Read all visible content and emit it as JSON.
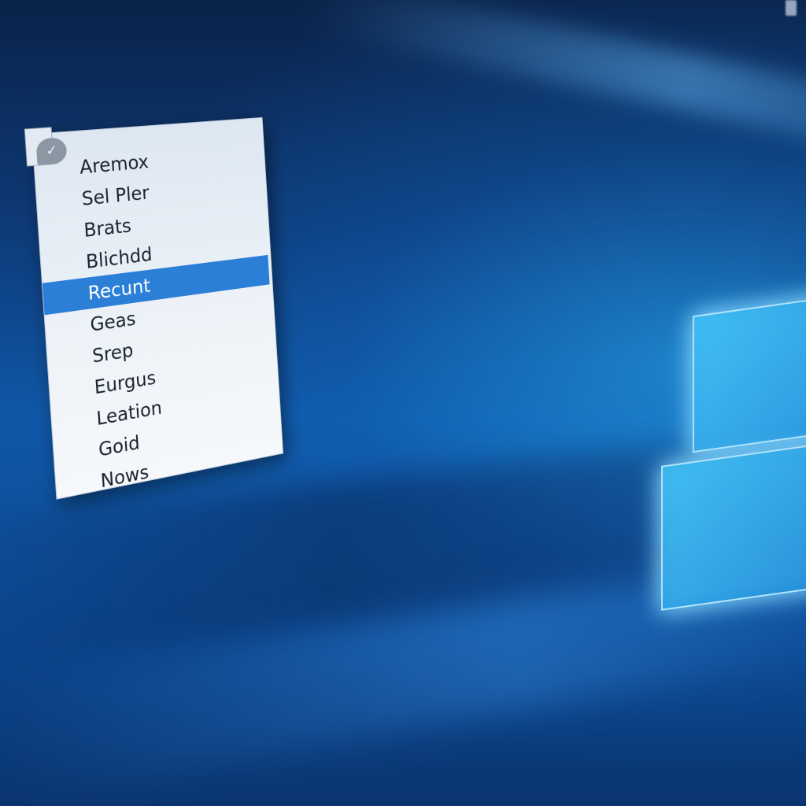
{
  "desktop": {
    "accent_color": "#2b7fd6",
    "background_color": "#0f58a8",
    "logo": "windows-logo"
  },
  "context_menu": {
    "icon": "document-chat-icon",
    "items": [
      {
        "label": "Aremox",
        "selected": false
      },
      {
        "label": "Sel Pler",
        "selected": false
      },
      {
        "label": "Brats",
        "selected": false
      },
      {
        "label": "Blichdd",
        "selected": false
      },
      {
        "label": "Recunt",
        "selected": true
      },
      {
        "label": "Geas",
        "selected": false
      },
      {
        "label": "Srep",
        "selected": false
      },
      {
        "label": "Eurgus",
        "selected": false
      },
      {
        "label": "Leation",
        "selected": false
      },
      {
        "label": "Goid",
        "selected": false
      },
      {
        "label": "Nows",
        "selected": false
      }
    ]
  }
}
